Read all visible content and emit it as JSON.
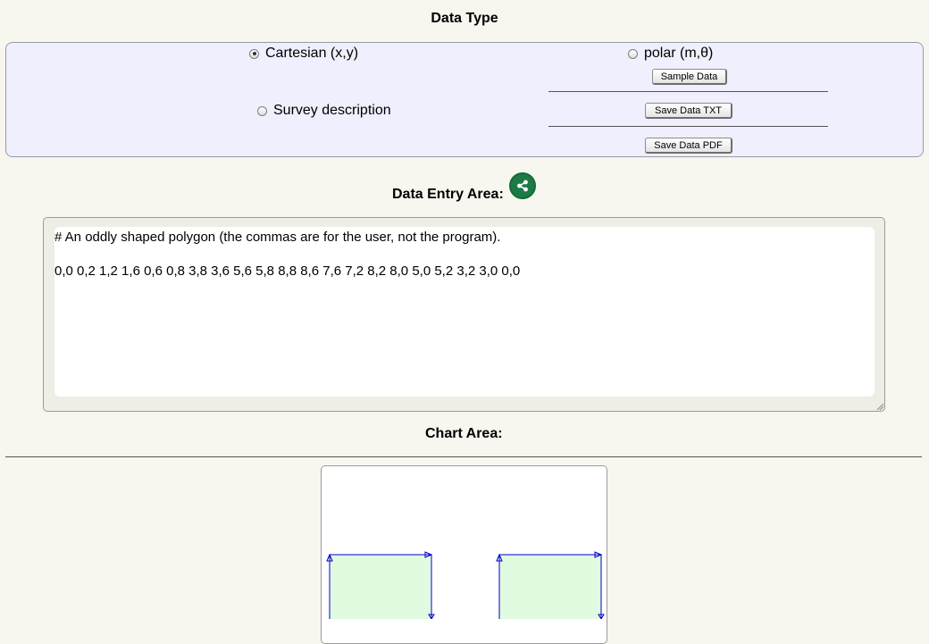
{
  "data_type": {
    "title": "Data Type",
    "cartesian_label": "Cartesian (x,y)",
    "polar_label": "polar (m,θ)",
    "survey_label": "Survey description",
    "selected": "cartesian"
  },
  "buttons": {
    "sample_data": "Sample Data",
    "save_txt": "Save Data TXT",
    "save_pdf": "Save Data PDF"
  },
  "entry": {
    "title": "Data Entry Area:",
    "comment_line": "# An oddly shaped polygon (the commas are for the user, not the program).",
    "data_line": "0,0 0,2 1,2 1,6 0,6 0,8 3,8 3,6 5,6 5,8 8,8 8,6 7,6 7,2 8,2 8,0 5,0 5,2 3,2 3,0 0,0"
  },
  "chart": {
    "title": "Chart Area:",
    "fill_color": "#e0fbe0",
    "stroke_color": "#0000cc"
  },
  "icons": {
    "share": "share-icon",
    "resize": "resize-handle-icon"
  }
}
